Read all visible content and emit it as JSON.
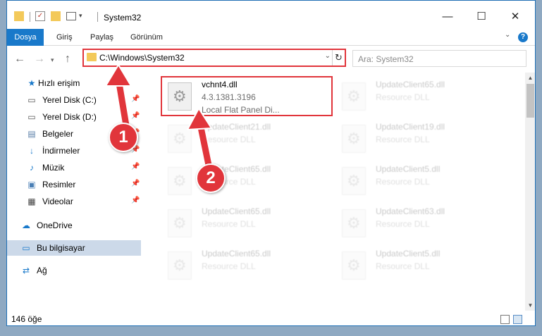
{
  "window": {
    "title": "System32",
    "controls": {
      "minimize": "—",
      "maximize": "☐",
      "close": "✕"
    }
  },
  "ribbon": {
    "tabs": [
      {
        "label": "Dosya"
      },
      {
        "label": "Giriş"
      },
      {
        "label": "Paylaş"
      },
      {
        "label": "Görünüm"
      }
    ],
    "help_icon": "?"
  },
  "address_bar": {
    "path": "C:\\Windows\\System32"
  },
  "search": {
    "placeholder": "Ara: System32"
  },
  "sidebar": {
    "items": [
      {
        "label": "Hızlı erişim",
        "icon": "star-icon"
      },
      {
        "label": "Yerel Disk (C:)",
        "icon": "drive-icon",
        "pinned": true
      },
      {
        "label": "Yerel Disk (D:)",
        "icon": "drive-icon",
        "pinned": true
      },
      {
        "label": "Belgeler",
        "icon": "documents-icon",
        "pinned": true
      },
      {
        "label": "İndirmeler",
        "icon": "download-icon",
        "pinned": true
      },
      {
        "label": "Müzik",
        "icon": "music-icon",
        "pinned": true
      },
      {
        "label": "Resimler",
        "icon": "pictures-icon",
        "pinned": true
      },
      {
        "label": "Videolar",
        "icon": "video-icon",
        "pinned": true
      },
      {
        "label": "OneDrive",
        "icon": "cloud-icon"
      },
      {
        "label": "Bu bilgisayar",
        "icon": "computer-icon",
        "selected": true
      },
      {
        "label": "Ağ",
        "icon": "network-icon"
      }
    ]
  },
  "files": [
    {
      "name": "vchnt4.dll",
      "version": "4.3.1381.3196",
      "description": "Local Flat Panel Di..."
    },
    {
      "name": "UpdateClient65.dll",
      "version": "",
      "description": "Resource DLL"
    },
    {
      "name": "UpdateClient21.dll",
      "version": "",
      "description": "Resource DLL"
    },
    {
      "name": "UpdateClient19.dll",
      "version": "",
      "description": "Resource DLL"
    },
    {
      "name": "UpdateClient65.dll",
      "version": "",
      "description": "Resource DLL"
    },
    {
      "name": "UpdateClient5.dll",
      "version": "",
      "description": "Resource DLL"
    },
    {
      "name": "UpdateClient65.dll",
      "version": "",
      "description": "Resource DLL"
    },
    {
      "name": "UpdateClient63.dll",
      "version": "",
      "description": "Resource DLL"
    },
    {
      "name": "UpdateClient65.dll",
      "version": "",
      "description": "Resource DLL"
    },
    {
      "name": "UpdateClient5.dll",
      "version": "",
      "description": "Resource DLL"
    }
  ],
  "status_bar": {
    "count": "146 öğe"
  },
  "annotations": {
    "step1": "1",
    "step2": "2"
  },
  "colors": {
    "accent": "#1979ca",
    "highlight": "#e1353b"
  }
}
